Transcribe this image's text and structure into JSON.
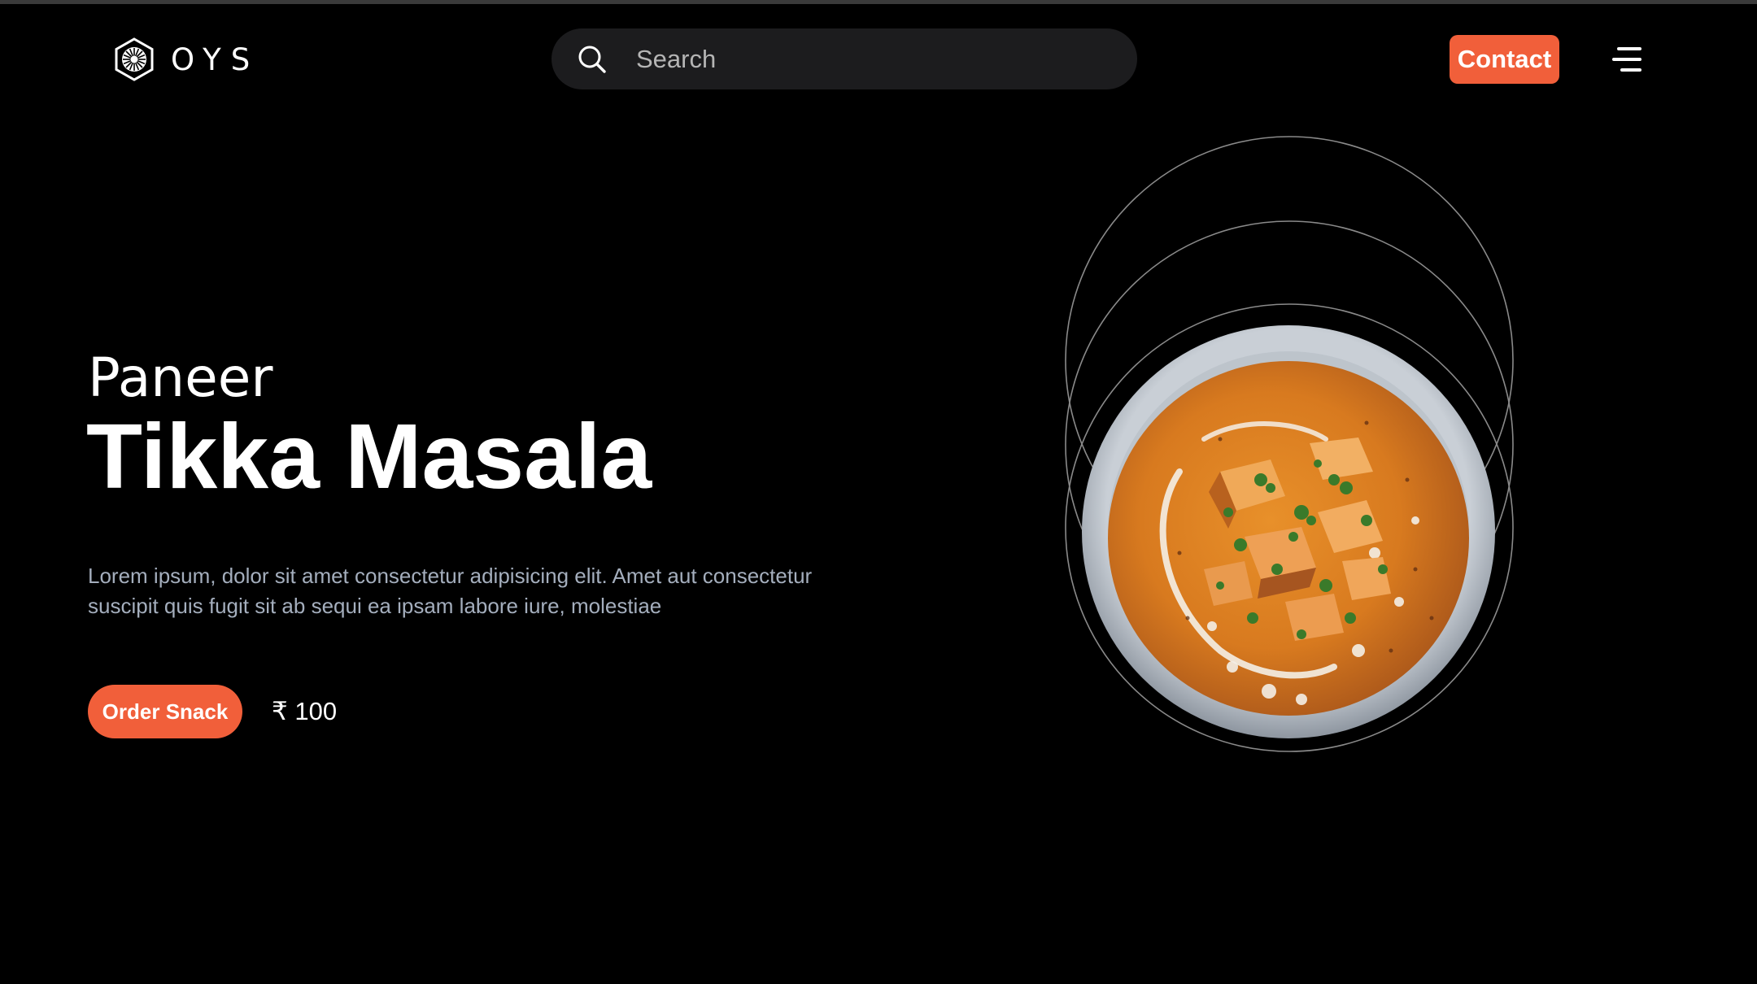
{
  "header": {
    "logo_text": "OYS",
    "search": {
      "placeholder": "Search",
      "value": ""
    },
    "contact_label": "Contact"
  },
  "hero": {
    "subtitle": "Paneer",
    "title": "Tikka Masala",
    "description": "Lorem ipsum, dolor sit amet consectetur adipisicing elit. Amet aut consectetur suscipit quis fugit sit ab sequi ea ipsam labore iure, molestiae",
    "order_label": "Order Snack",
    "price": "₹ 100"
  },
  "colors": {
    "background": "#000000",
    "accent": "#f15f3a",
    "search_bg": "#1c1c1e",
    "description_text": "#a4aebd",
    "ring_stroke": "#8a8a8a"
  },
  "icons": {
    "logo": "hexagon-logo-icon",
    "search": "search-icon",
    "menu": "hamburger-menu-icon"
  }
}
